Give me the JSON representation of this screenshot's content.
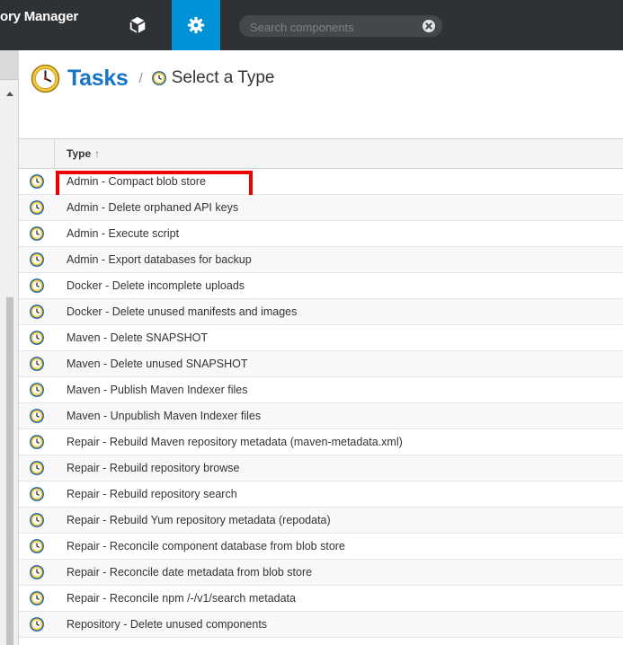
{
  "header": {
    "brand": "ory Manager",
    "browse_icon": "cube-icon",
    "admin_icon": "gear-icon",
    "search": {
      "placeholder": "Search components",
      "clear_icon": "clear-icon"
    },
    "colors": {
      "bar": "#2f3235",
      "active": "#0091d7"
    }
  },
  "breadcrumb": {
    "icon": "clock-icon",
    "root": "Tasks",
    "separator": "/",
    "current": "Select a Type"
  },
  "grid": {
    "column_header": "Type",
    "sort_icon": "↑",
    "row_icon": "clock-icon",
    "rows": [
      "Admin - Compact blob store",
      "Admin - Delete orphaned API keys",
      "Admin - Execute script",
      "Admin - Export databases for backup",
      "Docker - Delete incomplete uploads",
      "Docker - Delete unused manifests and images",
      "Maven - Delete SNAPSHOT",
      "Maven - Delete unused SNAPSHOT",
      "Maven - Publish Maven Indexer files",
      "Maven - Unpublish Maven Indexer files",
      "Repair - Rebuild Maven repository metadata (maven-metadata.xml)",
      "Repair - Rebuild repository browse",
      "Repair - Rebuild repository search",
      "Repair - Rebuild Yum repository metadata (repodata)",
      "Repair - Reconcile component database from blob store",
      "Repair - Reconcile date metadata from blob store",
      "Repair - Reconcile npm /-/v1/search metadata",
      "Repository - Delete unused components"
    ],
    "highlighted_row": 0,
    "highlight_color": "#ee0000"
  }
}
